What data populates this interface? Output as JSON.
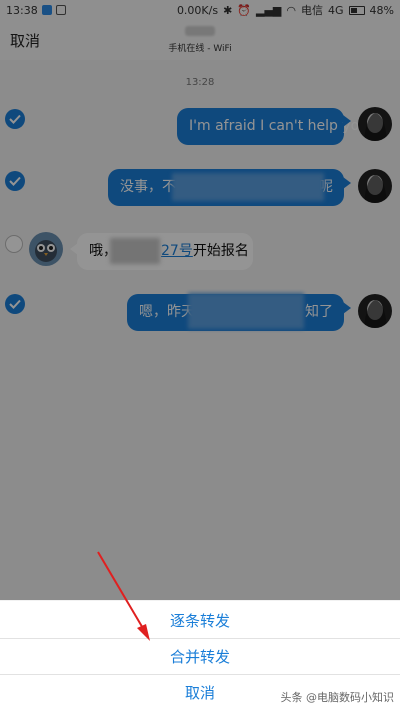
{
  "status_bar": {
    "time": "13:38",
    "network_speed": "0.00K/s",
    "carrier": "电信",
    "network_type": "4G",
    "battery": "48%"
  },
  "header": {
    "cancel_label": "取消",
    "subtitle": "手机在线 - WiFi"
  },
  "chat": {
    "timestamp": "13:28",
    "messages": [
      {
        "direction": "out",
        "selected": true,
        "text": "I'm afraid I can't help you"
      },
      {
        "direction": "out",
        "selected": true,
        "text_start": "没事，不是",
        "text_end": "呢"
      },
      {
        "direction": "in",
        "selected": false,
        "text_start": "哦，",
        "link_text": "27号",
        "text_end": "开始报名"
      },
      {
        "direction": "out",
        "selected": true,
        "text_start": "嗯，昨天",
        "text_end": "知了"
      }
    ]
  },
  "action_sheet": {
    "items": [
      "逐条转发",
      "合并转发",
      "取消"
    ]
  },
  "watermark": "头条 @电脑数码小知识",
  "colors": {
    "accent": "#1a7ed8",
    "overlay": "rgba(0,0,0,0.42)"
  }
}
